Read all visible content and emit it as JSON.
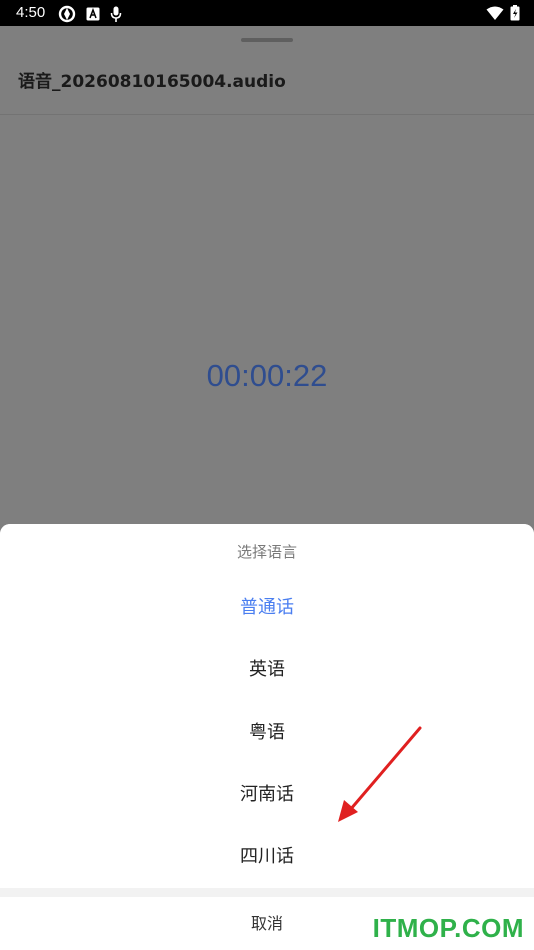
{
  "status_bar": {
    "time": "4:50",
    "left_icons": [
      "sync-icon",
      "text-icon",
      "mic-icon"
    ],
    "right_icons": [
      "wifi-icon",
      "battery-icon"
    ]
  },
  "recording": {
    "file_name": "语音_20260810165004.audio",
    "elapsed": "00:00:22"
  },
  "language_sheet": {
    "title": "选择语言",
    "options": [
      "普通话",
      "英语",
      "粤语",
      "河南话",
      "四川话"
    ],
    "selected_index": 0,
    "cancel_label": "取消",
    "accent_color": "#4a7ef0"
  },
  "watermark": "ITMOP.COM",
  "annotation": {
    "arrow_color": "#e02020"
  }
}
